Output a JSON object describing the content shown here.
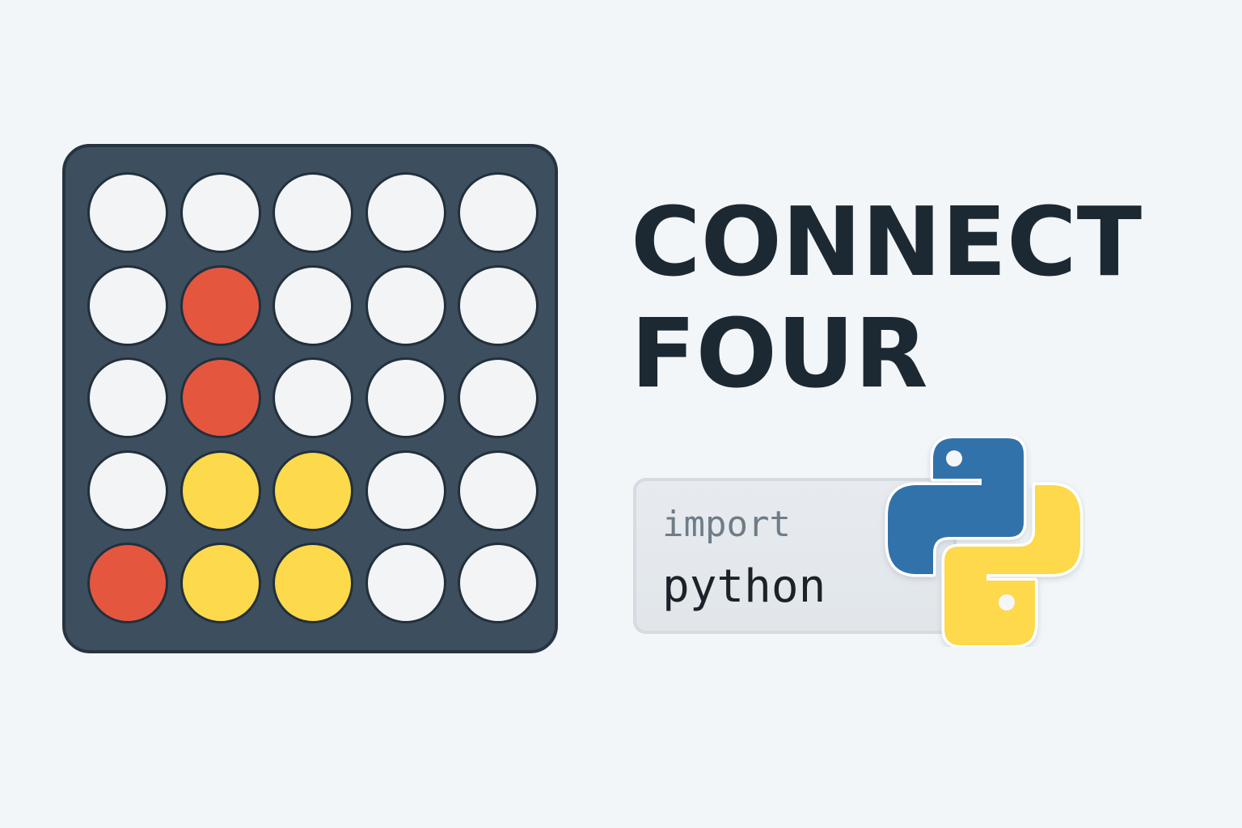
{
  "title": {
    "line1": "CONNECT",
    "line2": "FOUR"
  },
  "code": {
    "keyword": "import",
    "module": "python"
  },
  "board": {
    "rows": 5,
    "cols": 5,
    "cells": [
      [
        "empty",
        "empty",
        "empty",
        "empty",
        "empty"
      ],
      [
        "empty",
        "red",
        "empty",
        "empty",
        "empty"
      ],
      [
        "empty",
        "red",
        "empty",
        "empty",
        "empty"
      ],
      [
        "empty",
        "yellow",
        "yellow",
        "empty",
        "empty"
      ],
      [
        "red",
        "yellow",
        "yellow",
        "empty",
        "empty"
      ]
    ]
  },
  "colors": {
    "background": "#f2f6f9",
    "board": "#3d4f5e",
    "board_border": "#263441",
    "empty_slot": "#f2f4f6",
    "red_piece": "#e5563f",
    "yellow_piece": "#fdd94c",
    "title_text": "#1c2832",
    "python_blue": "#3372aa",
    "python_yellow": "#fdd94c"
  },
  "icons": {
    "logo": "python-logo-icon"
  }
}
